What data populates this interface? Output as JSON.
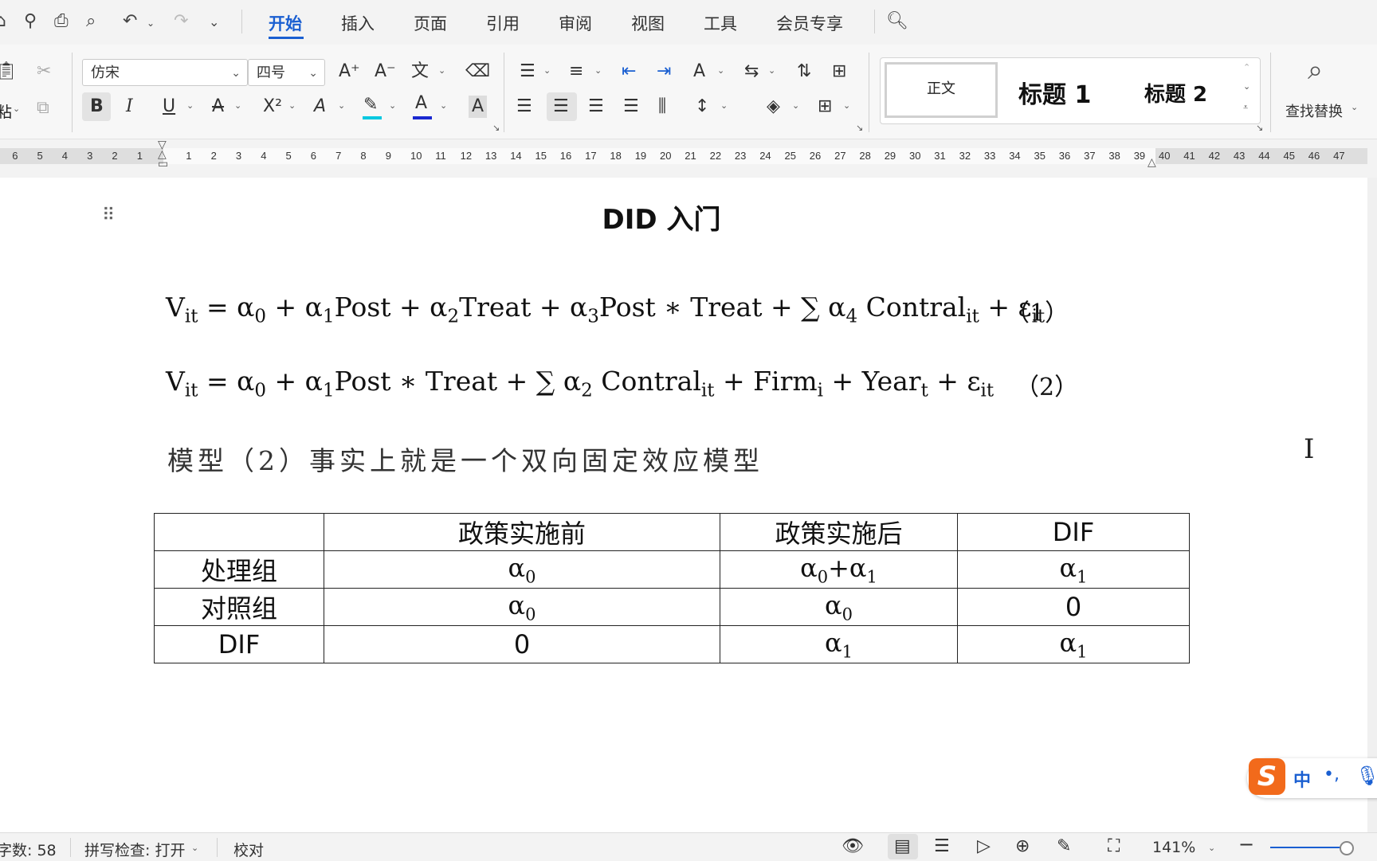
{
  "ribbon_tabs": [
    "开始",
    "插入",
    "页面",
    "引用",
    "审阅",
    "视图",
    "工具",
    "会员专享"
  ],
  "active_tab": "开始",
  "font": {
    "name": "仿宋",
    "size": "四号"
  },
  "styles": {
    "normal": "正文",
    "heading1": "标题 1",
    "heading2": "标题 2"
  },
  "find_replace_label": "查找替换",
  "paste_label": "粘",
  "ruler_left": [
    "6",
    "5",
    "4",
    "3",
    "2",
    "1"
  ],
  "ruler_right": [
    "1",
    "2",
    "3",
    "4",
    "5",
    "6",
    "7",
    "8",
    "9",
    "10",
    "11",
    "12",
    "13",
    "14",
    "15",
    "16",
    "17",
    "18",
    "19",
    "20",
    "21",
    "22",
    "23",
    "24",
    "25",
    "26",
    "27",
    "28",
    "29",
    "30",
    "31",
    "32",
    "33",
    "34",
    "35",
    "36",
    "37",
    "38",
    "39",
    "40",
    "41",
    "42",
    "43",
    "44",
    "45",
    "46",
    "47"
  ],
  "document": {
    "title": "DID 入门",
    "eq1_number": "（1）",
    "eq2_number": "（2）",
    "paragraph": "模型（2）事实上就是一个双向固定效应模型",
    "table": {
      "headers": [
        "",
        "政策实施前",
        "政策实施后",
        "DIF"
      ],
      "row_labels": [
        "处理组",
        "对照组",
        "DIF"
      ],
      "zero": "0"
    }
  },
  "status_bar": {
    "word_count": "字数: 58",
    "spell_check": "拼写检查: 打开",
    "proofread": "校对",
    "zoom": "141%"
  },
  "ime": {
    "logo": "S",
    "mode": "中",
    "punct": "•,"
  },
  "colors": {
    "accent": "#1a5fd1",
    "ime_orange": "#f26a1b",
    "highlight_cyan": "#00c8e0",
    "font_color_blue": "#1a28d0"
  }
}
